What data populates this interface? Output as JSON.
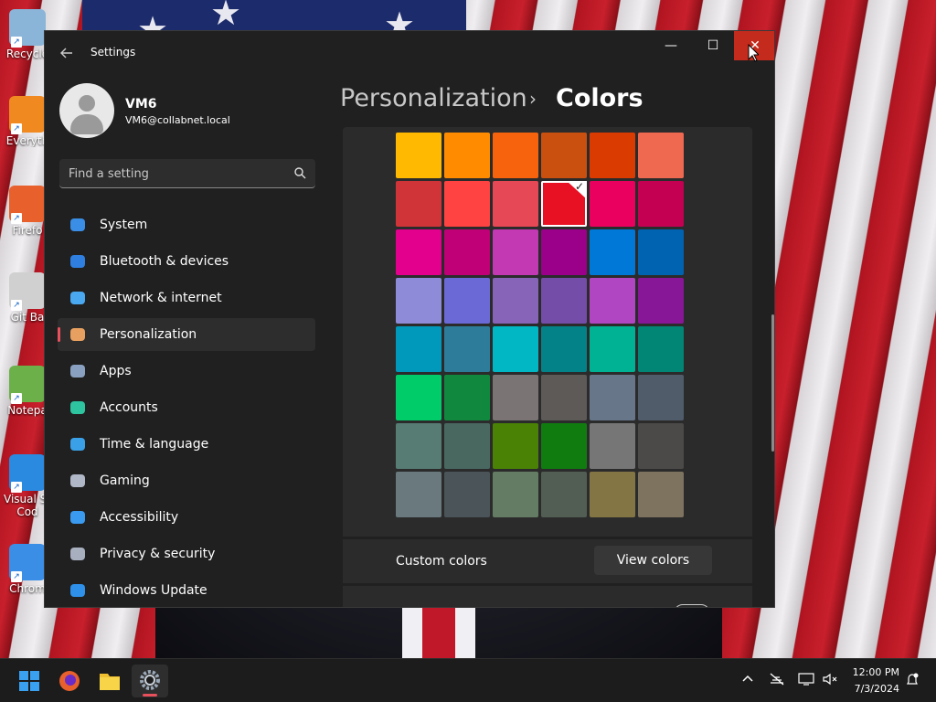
{
  "window": {
    "app_title": "Settings",
    "back_icon": "back-arrow-icon",
    "controls": {
      "minimize": "—",
      "maximize": "☐",
      "close": "✕"
    }
  },
  "profile": {
    "name": "VM6",
    "email": "VM6@collabnet.local"
  },
  "search": {
    "placeholder": "Find a setting"
  },
  "nav": [
    {
      "label": "System",
      "icon": "monitor-icon",
      "color": "#3a8ee6"
    },
    {
      "label": "Bluetooth & devices",
      "icon": "bluetooth-icon",
      "color": "#2f7fe0"
    },
    {
      "label": "Network & internet",
      "icon": "wifi-icon",
      "color": "#4aa8f0"
    },
    {
      "label": "Personalization",
      "icon": "paintbrush-icon",
      "color": "#e8a060",
      "selected": true
    },
    {
      "label": "Apps",
      "icon": "apps-icon",
      "color": "#8aa0c0"
    },
    {
      "label": "Accounts",
      "icon": "person-icon",
      "color": "#2ec4a0"
    },
    {
      "label": "Time & language",
      "icon": "globe-clock-icon",
      "color": "#3aa0e8"
    },
    {
      "label": "Gaming",
      "icon": "gamepad-icon",
      "color": "#b0b8c8"
    },
    {
      "label": "Accessibility",
      "icon": "accessibility-icon",
      "color": "#3a9af0"
    },
    {
      "label": "Privacy & security",
      "icon": "shield-icon",
      "color": "#a8b0c0"
    },
    {
      "label": "Windows Update",
      "icon": "update-icon",
      "color": "#2e90e8"
    }
  ],
  "breadcrumb": {
    "parent": "Personalization",
    "separator": "›",
    "current": "Colors"
  },
  "accent_colors": [
    [
      "#ffb900",
      "#ff8c00",
      "#f7630c",
      "#ca5010",
      "#da3b01",
      "#ef6950"
    ],
    [
      "#d13438",
      "#ff4343",
      "#e74856",
      "#e81123",
      "#ea005e",
      "#c30052"
    ],
    [
      "#e3008c",
      "#bf0077",
      "#c239b3",
      "#9a0089",
      "#0078d7",
      "#0063b1"
    ],
    [
      "#8e8cd8",
      "#6b69d6",
      "#8764b8",
      "#744da9",
      "#b146c2",
      "#881798"
    ],
    [
      "#0099bc",
      "#2d7d9a",
      "#00b7c3",
      "#038387",
      "#00b294",
      "#018574"
    ],
    [
      "#00cc6a",
      "#10893e",
      "#7a7574",
      "#5d5a58",
      "#68768a",
      "#515c6b"
    ],
    [
      "#567c73",
      "#486860",
      "#498205",
      "#107c10",
      "#767676",
      "#4c4a48"
    ],
    [
      "#69797e",
      "#4a5459",
      "#647c64",
      "#525e54",
      "#847545",
      "#7e735f"
    ]
  ],
  "selected_color": {
    "row": 1,
    "col": 3
  },
  "custom_colors": {
    "label": "Custom colors",
    "button": "View colors"
  },
  "desktop_icons": [
    {
      "label": "Recycle",
      "icon": "recycle-bin-icon",
      "color": "#8ab4d8"
    },
    {
      "label": "Everyth",
      "icon": "everything-search-icon",
      "color": "#f08a20"
    },
    {
      "label": "Firefo",
      "icon": "firefox-icon",
      "color": "#e8602c"
    },
    {
      "label": "Git Ba",
      "icon": "git-bash-icon",
      "color": "#d0d0d0"
    },
    {
      "label": "Notepa",
      "icon": "notepad-icon",
      "color": "#6cb04a"
    },
    {
      "label": "Visual St",
      "label2": "Cod",
      "icon": "vscode-icon",
      "color": "#2a8ae0"
    },
    {
      "label": "Chrom",
      "icon": "chrome-icon",
      "color": "#3a8ee6"
    }
  ],
  "taskbar": {
    "apps": [
      "windows-start-icon",
      "firefox-icon",
      "file-explorer-icon",
      "settings-icon"
    ],
    "tray": [
      "chevron-up-icon",
      "network-off-icon",
      "display-icon",
      "volume-mute-icon",
      "notification-icon"
    ],
    "time": "12:00 PM",
    "date": "7/3/2024"
  }
}
